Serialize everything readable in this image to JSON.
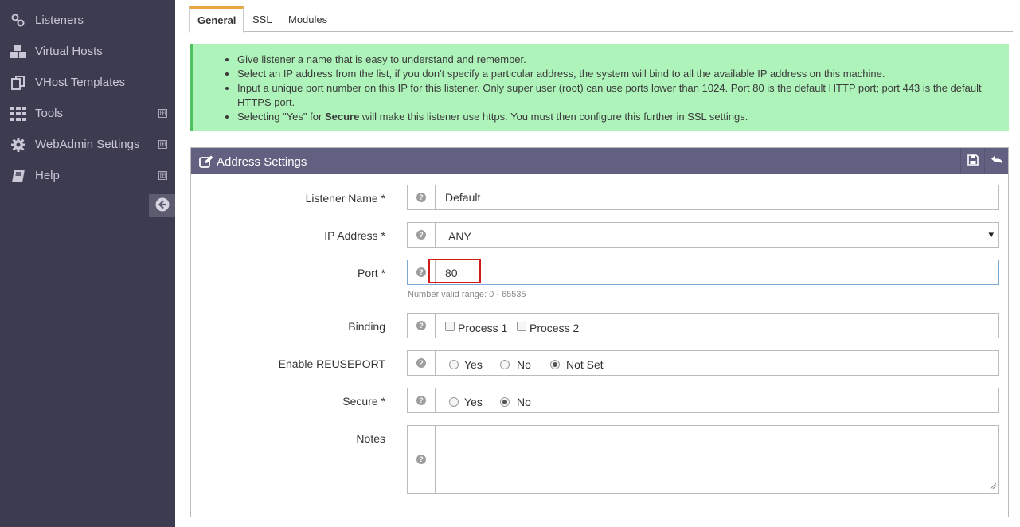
{
  "sidebar": {
    "items": [
      {
        "label": "Listeners",
        "icon": "link-icon"
      },
      {
        "label": "Virtual Hosts",
        "icon": "cubes-icon"
      },
      {
        "label": "VHost Templates",
        "icon": "copy-icon"
      },
      {
        "label": "Tools",
        "icon": "grid-icon",
        "expand": "⊞"
      },
      {
        "label": "WebAdmin Settings",
        "icon": "gear-icon",
        "expand": "⊞"
      },
      {
        "label": "Help",
        "icon": "book-icon",
        "expand": "⊞"
      }
    ],
    "collapse_icon": "arrow-left-circle-icon"
  },
  "tabs": [
    "General",
    "SSL",
    "Modules"
  ],
  "info": [
    "Give listener a name that is easy to understand and remember.",
    "Select an IP address from the list, if you don't specify a particular address, the system will bind to all the available IP address on this machine.",
    "Input a unique port number on this IP for this listener. Only super user (root) can use ports lower than 1024. Port 80 is the default HTTP port; port 443 is the default HTTPS port.",
    {
      "pre": "Selecting \"Yes\" for ",
      "bold": "Secure",
      "post": " will make this listener use https. You must then configure this further in SSL settings."
    }
  ],
  "panel": {
    "title": "Address Settings",
    "save_icon": "save-icon",
    "back_icon": "undo-icon"
  },
  "form": {
    "listener_name": {
      "label": "Listener Name *",
      "value": "Default"
    },
    "ip_address": {
      "label": "IP Address *",
      "value": "ANY",
      "arrow": "▾"
    },
    "port": {
      "label": "Port *",
      "value": "80",
      "hint": "Number valid range: 0 - 65535"
    },
    "binding": {
      "label": "Binding",
      "options": [
        "Process 1",
        "Process 2"
      ]
    },
    "reuseport": {
      "label": "Enable REUSEPORT",
      "options": [
        "Yes",
        "No",
        "Not Set"
      ],
      "selected": "Not Set"
    },
    "secure": {
      "label": "Secure *",
      "options": [
        "Yes",
        "No"
      ],
      "selected": "No"
    },
    "notes": {
      "label": "Notes",
      "value": ""
    },
    "help_glyph": "?"
  },
  "colors": {
    "sidebar_bg": "#3d3b4f",
    "panel_header": "#626080",
    "info_bg": "#aef3b9",
    "tab_accent": "#e8a73e",
    "highlight_box": "#d11a1a"
  }
}
